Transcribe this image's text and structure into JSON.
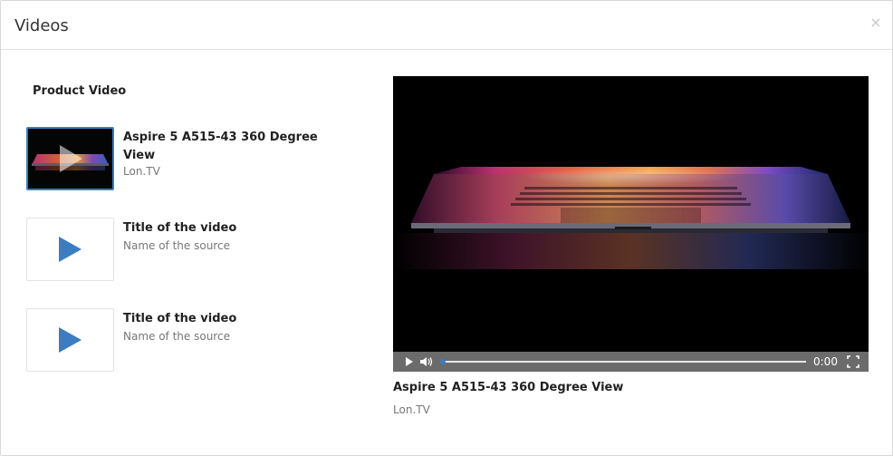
{
  "modal": {
    "title": "Videos",
    "close_icon": "close-icon"
  },
  "list": {
    "heading": "Product Video",
    "items": [
      {
        "title": "Aspire 5 A515-43 360 Degree View",
        "source": "Lon.TV",
        "active": true,
        "icon": "play-icon"
      },
      {
        "title": "Title of the video",
        "source": "Name of the source",
        "active": false,
        "icon": "play-icon"
      },
      {
        "title": "Title of the video",
        "source": "Name of the source",
        "active": false,
        "icon": "play-icon"
      }
    ]
  },
  "player": {
    "time": "0:00",
    "progress": 0,
    "icons": [
      "play-icon",
      "volume-icon",
      "fullscreen-icon"
    ]
  },
  "now_playing": {
    "title": "Aspire 5 A515-43 360 Degree View",
    "source": "Lon.TV"
  },
  "colors": {
    "accent": "#3a7dc2",
    "controls_bg": "#6b6b6b",
    "player_bg": "#000000"
  }
}
